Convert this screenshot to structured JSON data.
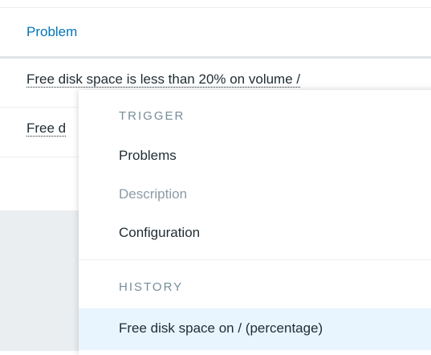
{
  "table": {
    "header": {
      "problem": "Problem"
    },
    "rows": [
      {
        "text": "Free disk space is less than 20% on volume /"
      },
      {
        "text": "Free d"
      }
    ]
  },
  "menu": {
    "trigger_header": "TRIGGER",
    "items": {
      "problems": "Problems",
      "description": "Description",
      "configuration": "Configuration"
    },
    "history_header": "HISTORY",
    "history_items": [
      {
        "label": "Free disk space on / (percentage)"
      }
    ]
  },
  "colors": {
    "link": "#0275b8",
    "text": "#1f2c33",
    "disabled": "#8c9ba5",
    "section_header": "#768d99",
    "hover_bg": "#e8f5ff",
    "gray_area": "#ebeef0"
  }
}
